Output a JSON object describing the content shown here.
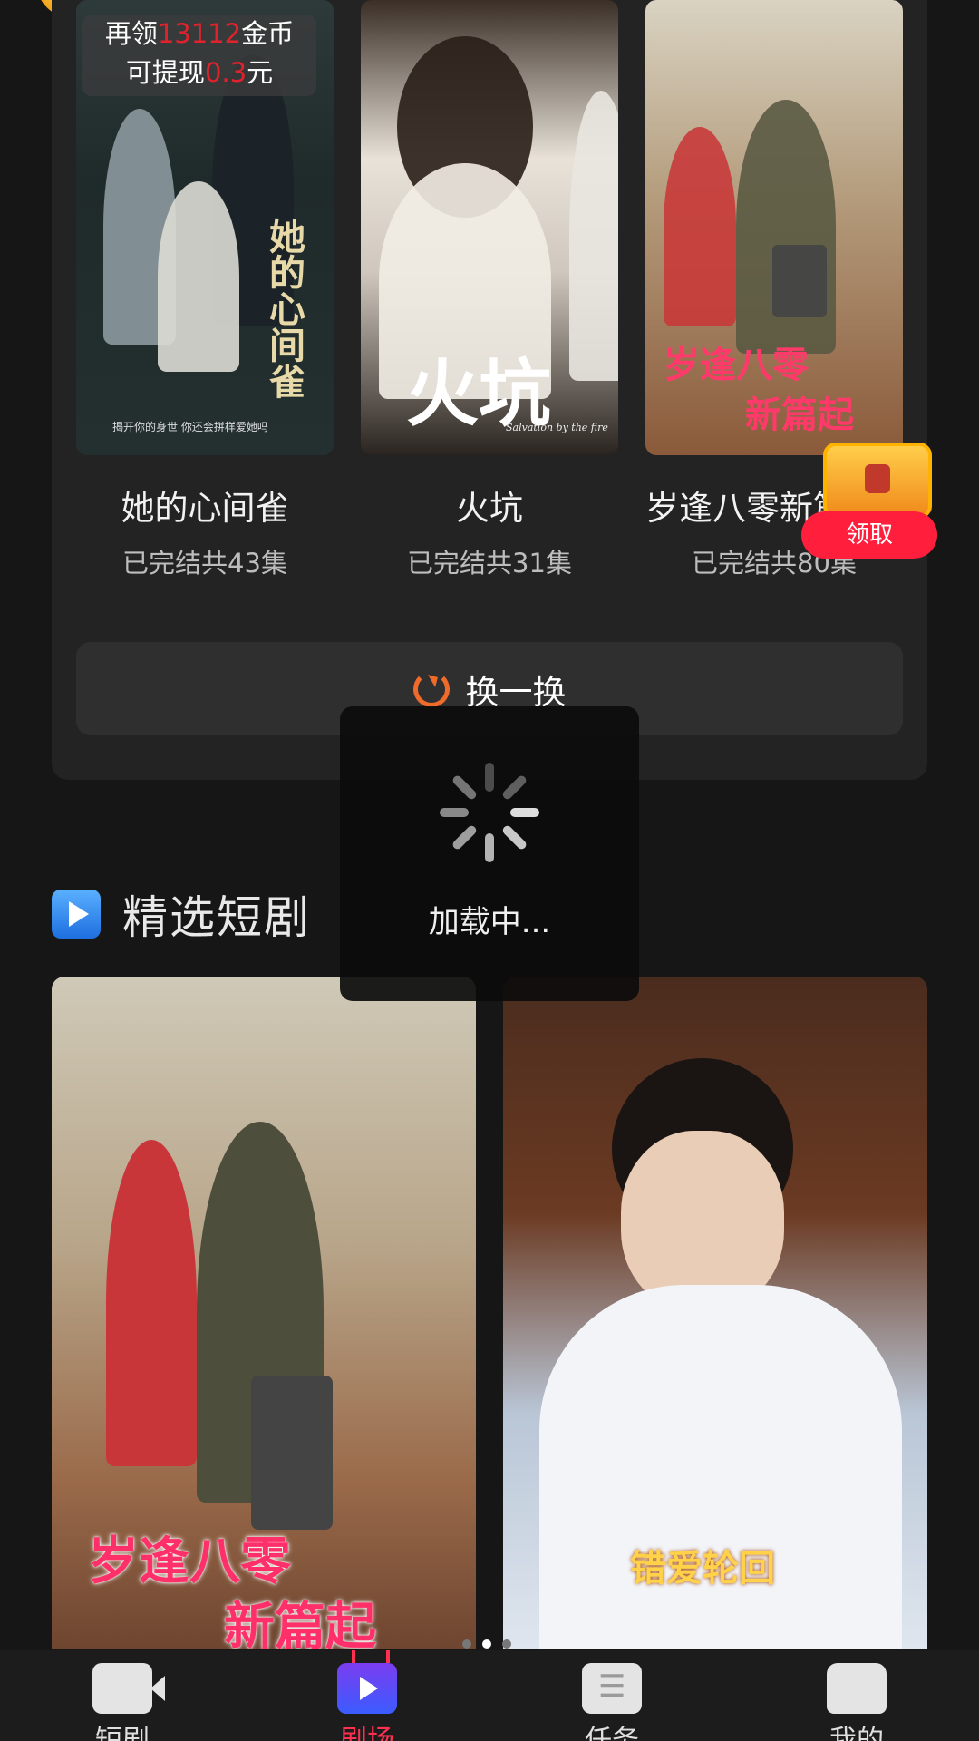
{
  "coin_banner": {
    "line1_prefix": "再领",
    "coins": "13112",
    "line1_suffix": "金币",
    "line2_prefix": "可提现",
    "cash": "0.3",
    "line2_suffix": "元"
  },
  "recommended": [
    {
      "title": "她的心间雀",
      "meta": "已完结共43集",
      "poster_caption": "她的心间雀",
      "poster_tagline": "揭开你的身世 你还会拼样爱她吗"
    },
    {
      "title": "火坑",
      "meta": "已完结共31集",
      "poster_caption": "火坑",
      "poster_tagline": "Salvation by the fire"
    },
    {
      "title": "岁逢八零新篇起",
      "meta": "已完结共80集",
      "poster_caption_1": "岁逢八零",
      "poster_caption_2": "新篇起"
    }
  ],
  "refresh": {
    "label": "换一换"
  },
  "reward": {
    "claim_label": "领取"
  },
  "loading": {
    "text": "加载中..."
  },
  "section": {
    "title": "精选短剧"
  },
  "featured": [
    {
      "caption_1": "岁逢八零",
      "caption_2": "新篇起"
    },
    {
      "caption_1": "错爱轮回"
    }
  ],
  "carousel": {
    "count": 3,
    "active": 1
  },
  "nav": {
    "items": [
      {
        "label": "短剧",
        "icon": "video-icon",
        "active": false
      },
      {
        "label": "剧场",
        "icon": "theater-icon",
        "active": true
      },
      {
        "label": "任务",
        "icon": "task-icon",
        "active": false
      },
      {
        "label": "我的",
        "icon": "profile-icon",
        "active": false
      }
    ]
  },
  "colors": {
    "accent": "#ff3050",
    "highlight": "#e0222c",
    "refresh": "#f06a2a"
  }
}
